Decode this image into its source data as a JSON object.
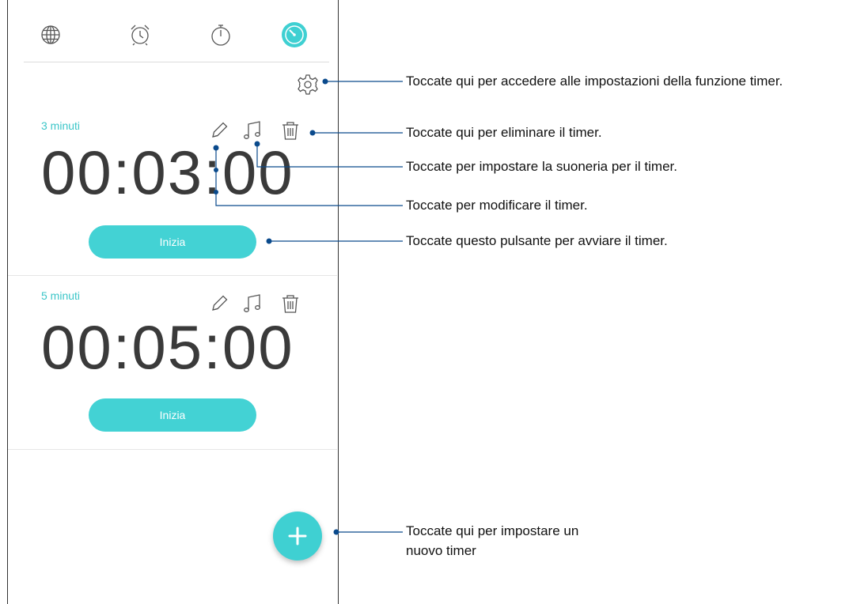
{
  "tabs": [
    {
      "name": "world-clock",
      "icon": "globe-icon"
    },
    {
      "name": "alarm",
      "icon": "alarm-clock-icon"
    },
    {
      "name": "stopwatch",
      "icon": "stopwatch-icon"
    },
    {
      "name": "timer",
      "icon": "timer-icon",
      "active": true
    }
  ],
  "settings_icon": "gear-icon",
  "timers": [
    {
      "label": "3 minuti",
      "time": "00:03:00",
      "start_label": "Inizia"
    },
    {
      "label": "5 minuti",
      "time": "00:05:00",
      "start_label": "Inizia"
    }
  ],
  "fab_icon": "plus-icon",
  "callouts": {
    "settings": "Toccate qui per accedere alle impostazioni della funzione timer.",
    "delete": "Toccate qui per eliminare il timer.",
    "ringtone": "Toccate per impostare la suoneria per il timer.",
    "edit": "Toccate per modificare il timer.",
    "start": "Toccate questo pulsante per avviare il timer.",
    "add_line1": "Toccate qui per impostare un",
    "add_line2": "nuovo timer"
  },
  "colors": {
    "accent": "#3fd0d2",
    "callout_line": "#0a4a8c",
    "text": "#3a3a3a"
  }
}
